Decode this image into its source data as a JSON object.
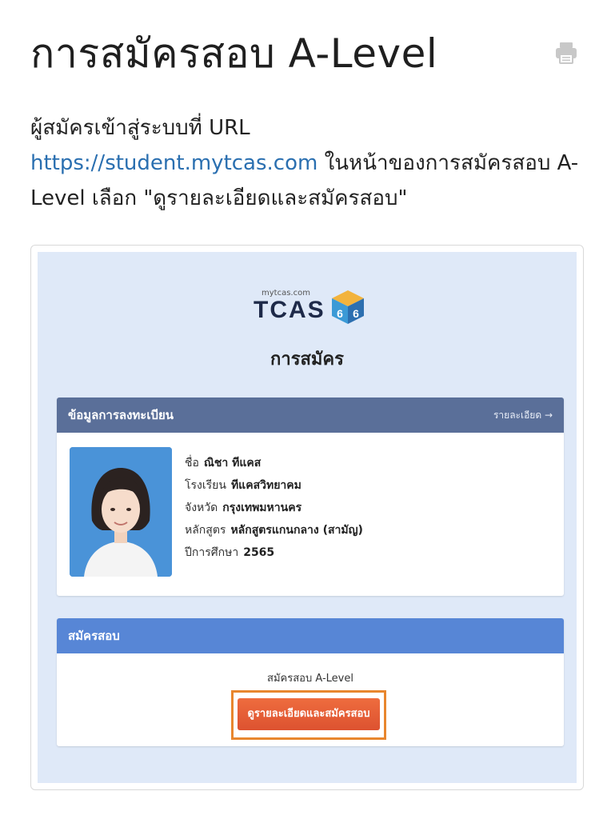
{
  "page": {
    "title": "การสมัครสอบ A-Level",
    "intro_prefix": "ผู้สมัครเข้าสู่ระบบที่ URL",
    "intro_link": "https://student.mytcas.com",
    "intro_suffix": " ในหน้าของการสมัครสอบ A-Level เลือก \"ดูรายละเอียดและสมัครสอบ\""
  },
  "embedded": {
    "logo_sub": "mytcas.com",
    "logo_main": "TCAS",
    "logo_year": "66",
    "heading": "การสมัคร",
    "registration_card": {
      "header": "ข้อมูลการลงทะเบียน",
      "detail_link": "รายละเอียด →",
      "fields": [
        {
          "label": "ชื่อ",
          "value": "ณิชา ทีแคส"
        },
        {
          "label": "โรงเรียน",
          "value": "ทีแคสวิทยาคม"
        },
        {
          "label": "จังหวัด",
          "value": "กรุงเทพมหานคร"
        },
        {
          "label": "หลักสูตร",
          "value": "หลักสูตรแกนกลาง (สามัญ)"
        },
        {
          "label": "ปีการศึกษา",
          "value": "2565"
        }
      ]
    },
    "exam_card": {
      "header": "สมัครสอบ",
      "label": "สมัครสอบ A-Level",
      "button": "ดูรายละเอียดและสมัครสอบ"
    }
  },
  "colors": {
    "link": "#2a6fb0",
    "info_header": "#5a6f99",
    "exam_header": "#5786d6",
    "button": "#e8623a",
    "highlight": "#e8862e",
    "panel_bg": "#dfe9f8"
  },
  "icons": {
    "print": "printer-icon"
  }
}
